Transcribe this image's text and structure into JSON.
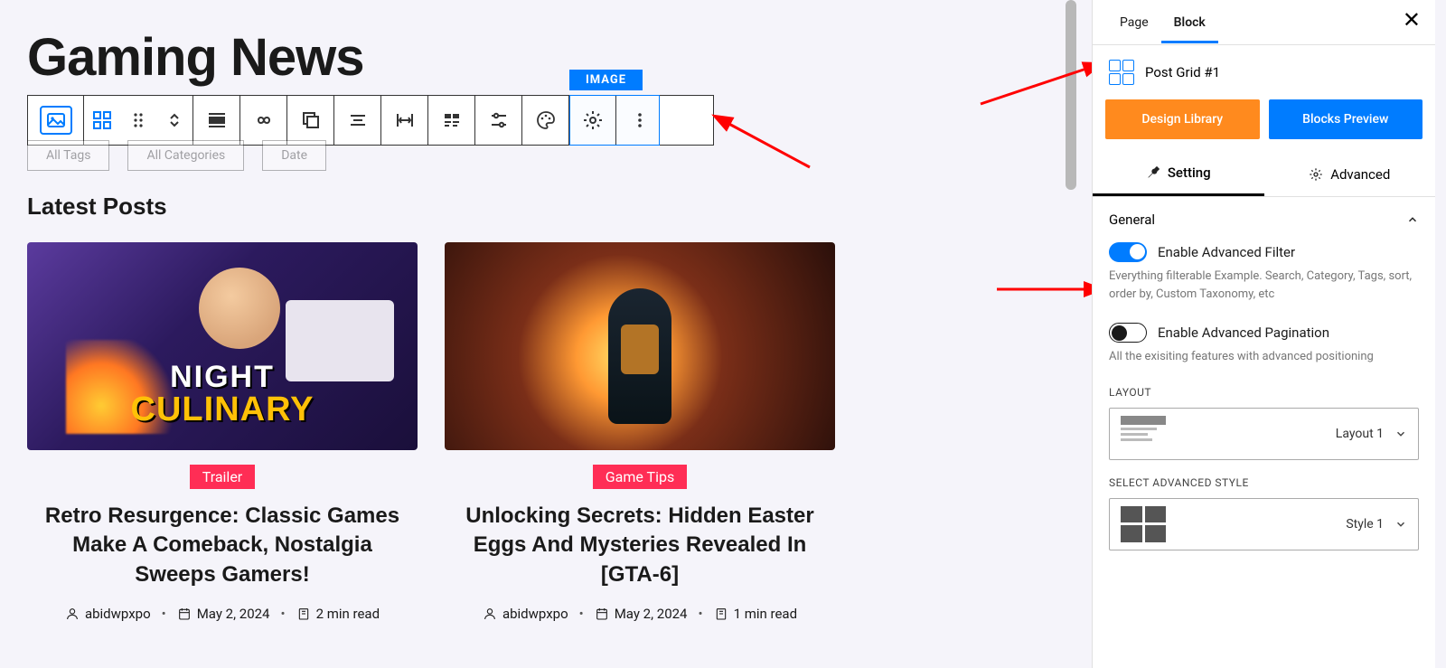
{
  "canvas": {
    "page_title": "Gaming News",
    "toolbar_tag": "IMAGE",
    "filters": [
      "All Tags",
      "All Categories",
      "Date"
    ],
    "section_title": "Latest Posts",
    "posts": [
      {
        "overlay_l1": "NIGHT",
        "overlay_l2": "CULINARY",
        "tag": "Trailer",
        "title": "Retro Resurgence: Classic Games Make A Comeback, Nostalgia Sweeps Gamers!",
        "author": "abidwpxpo",
        "date": "May 2, 2024",
        "read": "2 min read"
      },
      {
        "tag": "Game Tips",
        "title": "Unlocking Secrets: Hidden Easter Eggs And Mysteries Revealed In [GTA-6]",
        "author": "abidwpxpo",
        "date": "May 2, 2024",
        "read": "1 min read"
      }
    ]
  },
  "sidebar": {
    "tabs": {
      "page": "Page",
      "block": "Block"
    },
    "block_name": "Post Grid #1",
    "buttons": {
      "design": "Design Library",
      "preview": "Blocks Preview"
    },
    "subtabs": {
      "setting": "Setting",
      "advanced": "Advanced"
    },
    "panel_general": "General",
    "filter_toggle_label": "Enable Advanced Filter",
    "filter_hint": "Everything filterable Example. Search, Category, Tags, sort, order by, Custom Taxonomy, etc",
    "pagination_toggle_label": "Enable Advanced Pagination",
    "pagination_hint": "All the exisiting features with advanced positioning",
    "layout_label": "LAYOUT",
    "layout_value": "Layout 1",
    "style_label": "SELECT ADVANCED STYLE",
    "style_value": "Style 1"
  }
}
